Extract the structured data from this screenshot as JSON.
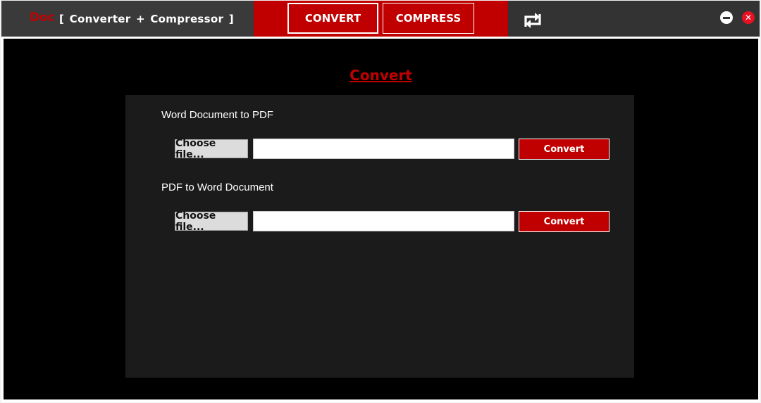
{
  "app": {
    "brand_prefix": "Doc",
    "brand_title": "[ Converter + Compressor ]"
  },
  "nav": {
    "convert_label": "CONVERT",
    "compress_label": "COMPRESS",
    "active": "CONVERT"
  },
  "window_controls": {
    "close_glyph": "✕"
  },
  "main": {
    "heading": "Convert",
    "sections": [
      {
        "label": "Word Document to PDF",
        "choose_label": "Choose file...",
        "path_value": "",
        "convert_label": "Convert"
      },
      {
        "label": "PDF to Word Document",
        "choose_label": "Choose file...",
        "path_value": "",
        "convert_label": "Convert"
      }
    ]
  },
  "icons": {
    "refresh": "refresh-icon",
    "minimize": "minimize-icon",
    "close": "close-icon"
  },
  "colors": {
    "accent": "#c00000",
    "titlebar": "#333333",
    "panel": "#1b1b1b",
    "background": "#000000"
  }
}
